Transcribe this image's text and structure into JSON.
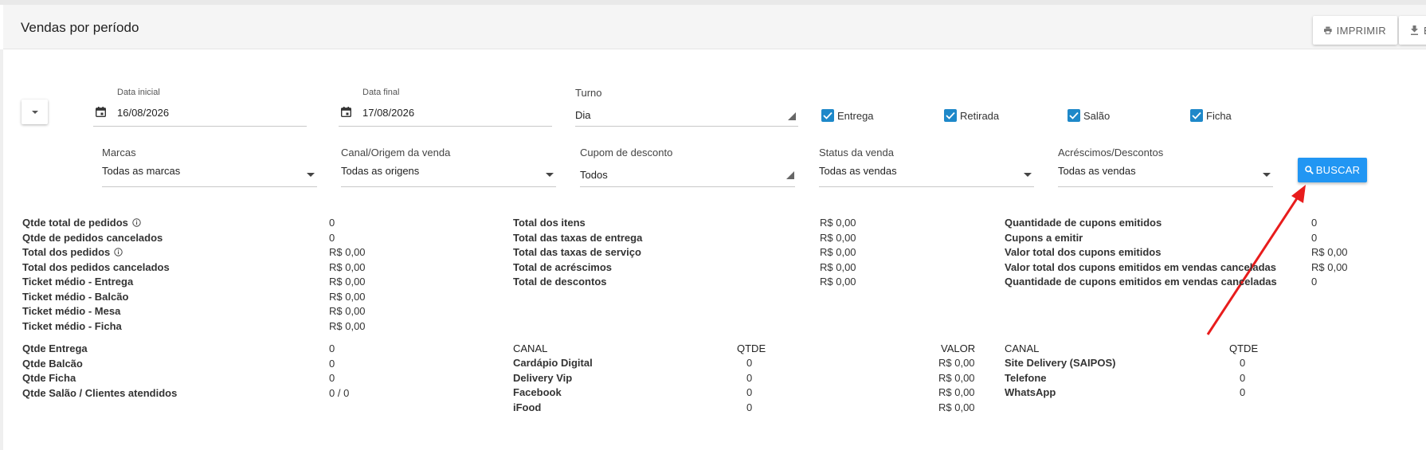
{
  "header": {
    "title": "Vendas por período",
    "print_label": "IMPRIMIR",
    "export_label": "E"
  },
  "filters": {
    "date_start": {
      "label": "Data inicial",
      "value": "16/08/2026"
    },
    "date_end": {
      "label": "Data final",
      "value": "17/08/2026"
    },
    "shift": {
      "label": "Turno",
      "value": "Dia"
    },
    "checkboxes": [
      {
        "label": "Entrega",
        "checked": true
      },
      {
        "label": "Retirada",
        "checked": true
      },
      {
        "label": "Salão",
        "checked": true
      },
      {
        "label": "Ficha",
        "checked": true
      }
    ],
    "brands": {
      "label": "Marcas",
      "value": "Todas as marcas"
    },
    "channel": {
      "label": "Canal/Origem da venda",
      "value": "Todas as origens"
    },
    "coupon": {
      "label": "Cupom de desconto",
      "value": "Todos"
    },
    "status": {
      "label": "Status da venda",
      "value": "Todas as vendas"
    },
    "adjustments": {
      "label": "Acréscimos/Descontos",
      "value": "Todas as vendas"
    },
    "search_label": "BUSCAR"
  },
  "stats_left": [
    {
      "label": "Qtde total de pedidos",
      "value": "0",
      "info": true
    },
    {
      "label": "Qtde de pedidos cancelados",
      "value": "0",
      "info": false
    },
    {
      "label": "Total dos pedidos",
      "value": "R$ 0,00",
      "info": true
    },
    {
      "label": "Total dos pedidos cancelados",
      "value": "R$ 0,00",
      "info": false
    },
    {
      "label": "Ticket médio - Entrega",
      "value": "R$ 0,00",
      "info": false
    },
    {
      "label": "Ticket médio - Balcão",
      "value": "R$ 0,00",
      "info": false
    },
    {
      "label": "Ticket médio - Mesa",
      "value": "R$ 0,00",
      "info": false
    },
    {
      "label": "Ticket médio - Ficha",
      "value": "R$ 0,00",
      "info": false
    }
  ],
  "stats_mid": [
    {
      "label": "Total dos itens",
      "value": "R$ 0,00"
    },
    {
      "label": "Total das taxas de entrega",
      "value": "R$ 0,00"
    },
    {
      "label": "Total das taxas de serviço",
      "value": "R$ 0,00"
    },
    {
      "label": "Total de acréscimos",
      "value": "R$ 0,00"
    },
    {
      "label": "Total de descontos",
      "value": "R$ 0,00"
    }
  ],
  "stats_right": [
    {
      "label": "Quantidade de cupons emitidos",
      "value": "0"
    },
    {
      "label": "Cupons a emitir",
      "value": "0"
    },
    {
      "label": "Valor total dos cupons emitidos",
      "value": "R$ 0,00"
    },
    {
      "label": "Valor total dos cupons emitidos em vendas canceladas",
      "value": "R$ 0,00"
    },
    {
      "label": "Quantidade de cupons emitidos em vendas canceladas",
      "value": "0"
    }
  ],
  "qty_stats": [
    {
      "label": "Qtde Entrega",
      "value": "0"
    },
    {
      "label": "Qtde Balcão",
      "value": "0"
    },
    {
      "label": "Qtde Ficha",
      "value": "0"
    },
    {
      "label": "Qtde Salão / Clientes atendidos",
      "value": "0 / 0"
    }
  ],
  "channels_table": {
    "headers": [
      "CANAL",
      "QTDE",
      "VALOR"
    ],
    "rows": [
      [
        "Cardápio Digital",
        "0",
        "R$ 0,00"
      ],
      [
        "Delivery Vip",
        "0",
        "R$ 0,00"
      ],
      [
        "Facebook",
        "0",
        "R$ 0,00"
      ],
      [
        "iFood",
        "0",
        "R$ 0,00"
      ]
    ]
  },
  "channels_table2": {
    "headers": [
      "CANAL",
      "QTDE"
    ],
    "rows": [
      [
        "Site Delivery (SAIPOS)",
        "0"
      ],
      [
        "Telefone",
        "0"
      ],
      [
        "WhatsApp",
        "0"
      ]
    ]
  },
  "colors": {
    "accent": "#2196f3",
    "checkbox": "#1e88c9",
    "annotation_arrow": "#e81c1c"
  }
}
